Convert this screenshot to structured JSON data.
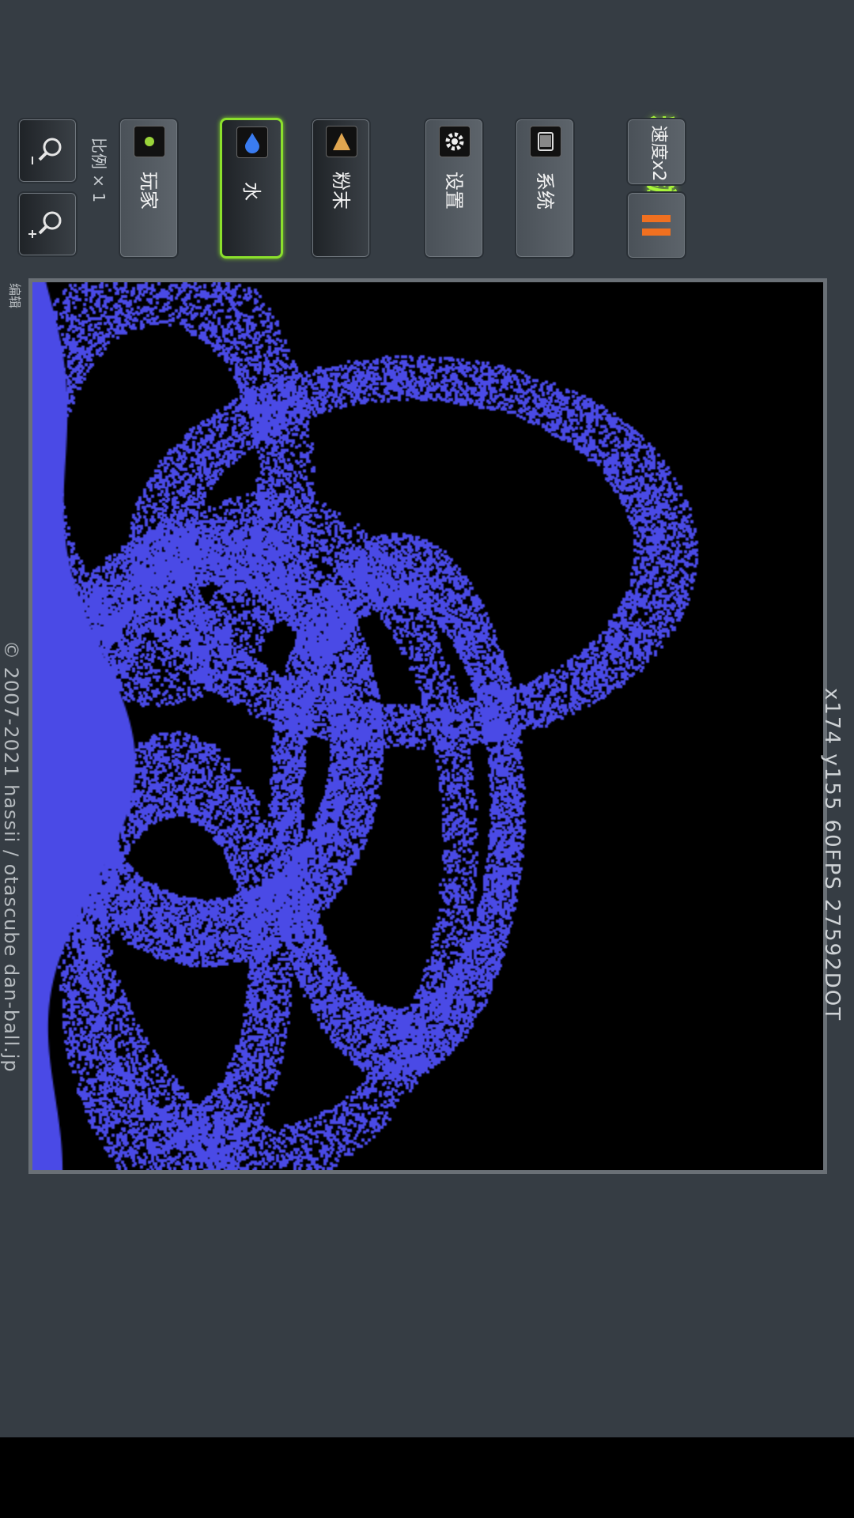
{
  "title": "粉末游戏",
  "toolbar": {
    "speed_label": "速度x2",
    "pause_icon": "pause-icon",
    "system_label": "系统",
    "settings_label": "设置",
    "powder_label": "粉末",
    "water_label": "水",
    "player_label": "玩家",
    "scale_label": "比例 × 1",
    "zoom_out_icon": "zoom-out-icon",
    "zoom_in_icon": "zoom-in-icon"
  },
  "status": {
    "coords": "x174 y155   60FPS   27592DOT",
    "copyright": "© 2007-2021 hassii / otascube  dan-ball.jp",
    "edit_label": "编辑"
  },
  "colors": {
    "background": "#363d44",
    "water": "#4a4ae6",
    "accent": "#a8f53a",
    "pause": "#f07020"
  }
}
